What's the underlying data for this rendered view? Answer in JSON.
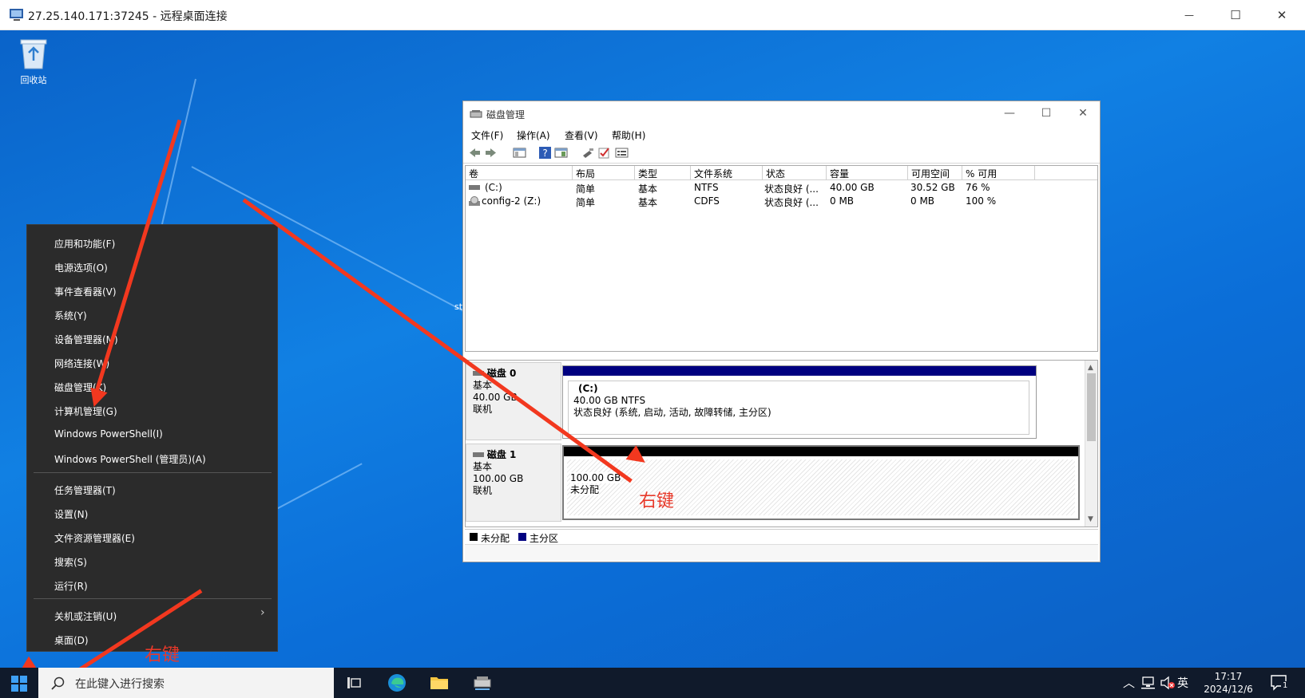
{
  "rdp": {
    "title": "27.25.140.171:37245 - 远程桌面连接",
    "minimize": "—",
    "maximize": "☐",
    "close": "✕"
  },
  "desktop": {
    "recycle_bin_label": "回收站",
    "partial_text": "st"
  },
  "disk_mgmt": {
    "title": "磁盘管理",
    "menu": [
      "文件(F)",
      "操作(A)",
      "查看(V)",
      "帮助(H)"
    ],
    "columns": [
      "卷",
      "布局",
      "类型",
      "文件系统",
      "状态",
      "容量",
      "可用空间",
      "% 可用"
    ],
    "volumes": [
      {
        "name": "(C:)",
        "layout": "简单",
        "type": "基本",
        "fs": "NTFS",
        "status": "状态良好 (...",
        "capacity": "40.00 GB",
        "free": "30.52 GB",
        "pct": "76 %"
      },
      {
        "name": "config-2 (Z:)",
        "layout": "简单",
        "type": "基本",
        "fs": "CDFS",
        "status": "状态良好 (...",
        "capacity": "0 MB",
        "free": "0 MB",
        "pct": "100 %"
      }
    ],
    "disks": [
      {
        "name": "磁盘 0",
        "kind": "基本",
        "size": "40.00 GB",
        "state": "联机",
        "part_name": "(C:)",
        "part_size": "40.00 GB NTFS",
        "part_status": "状态良好 (系统, 启动, 活动, 故障转储, 主分区)"
      },
      {
        "name": "磁盘 1",
        "kind": "基本",
        "size": "100.00 GB",
        "state": "联机",
        "part_size": "100.00 GB",
        "part_status": "未分配"
      }
    ],
    "legend": {
      "unallocated": "未分配",
      "primary": "主分区"
    }
  },
  "context_menu": {
    "items": [
      "应用和功能(F)",
      "电源选项(O)",
      "事件查看器(V)",
      "系统(Y)",
      "设备管理器(M)",
      "网络连接(W)",
      "磁盘管理(K)",
      "计算机管理(G)",
      "Windows PowerShell(I)",
      "Windows PowerShell (管理员)(A)"
    ],
    "items2": [
      "任务管理器(T)",
      "设置(N)",
      "文件资源管理器(E)",
      "搜索(S)",
      "运行(R)"
    ],
    "items3": [
      "关机或注销(U)",
      "桌面(D)"
    ]
  },
  "taskbar": {
    "search_placeholder": "在此键入进行搜索",
    "ime": "英",
    "time": "17:17",
    "date": "2024/12/6",
    "notification_count": "1"
  },
  "annotations": {
    "right_click_1": "右键",
    "right_click_2": "右键"
  },
  "colors": {
    "primary_partition": "#000080",
    "unallocated": "#000000",
    "annotation": "#f2381f",
    "desktop": "#0b6ed8"
  }
}
